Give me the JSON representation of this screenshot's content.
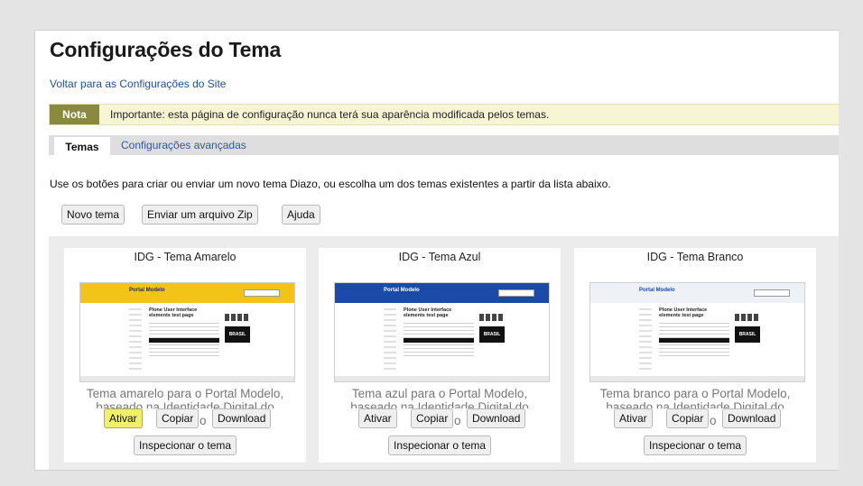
{
  "page": {
    "title": "Configurações do Tema",
    "back_link": "Voltar para as Configurações do Site"
  },
  "note": {
    "label": "Nota",
    "text": "Importante: esta página de configuração nunca terá sua aparência modificada pelos temas."
  },
  "tabs": [
    {
      "label": "Temas",
      "active": true
    },
    {
      "label": "Configurações avançadas",
      "active": false
    }
  ],
  "intro": "Use os botões para criar ou enviar um novo tema Diazo, ou escolha um dos temas existentes a partir da lista abaixo.",
  "toolbar": {
    "new_theme": "Novo tema",
    "upload_zip": "Enviar um arquivo Zip",
    "help": "Ajuda"
  },
  "themes": [
    {
      "name": "IDG - Tema Amarelo",
      "header_color": "#f2c417",
      "desc_line1": "Tema amarelo para o Portal Modelo,",
      "desc_line2": "baseado na Identidade Digital do",
      "desc_tail": "o",
      "thumb_logo": "Portal Modelo",
      "thumb_title": "Plone User Interface elements test page",
      "thumb_badge": "BRASIL",
      "activate": "Ativar",
      "copy": "Copiar",
      "download": "Download",
      "inspect": "Inspecionar o tema"
    },
    {
      "name": "IDG - Tema Azul",
      "header_color": "#1c4aa8",
      "desc_line1": "Tema azul para o Portal Modelo,",
      "desc_line2": "baseado na Identidade Digital do",
      "desc_tail": "o",
      "thumb_logo": "Portal Modelo",
      "thumb_title": "Plone User Interface elements test page",
      "thumb_badge": "BRASIL",
      "activate": "Ativar",
      "copy": "Copiar",
      "download": "Download",
      "inspect": "Inspecionar o tema"
    },
    {
      "name": "IDG - Tema Branco",
      "header_color": "#eef2f7",
      "desc_line1": "Tema branco para o Portal Modelo,",
      "desc_line2": "baseado na Identidade Digital do",
      "desc_tail": "o",
      "thumb_logo": "Portal Modelo",
      "thumb_title": "Plone User Interface elements test page",
      "thumb_badge": "BRASIL",
      "activate": "Ativar",
      "copy": "Copiar",
      "download": "Download",
      "inspect": "Inspecionar o tema"
    }
  ],
  "colors": {
    "highlight": "#f1f06a",
    "link": "#1f4f8f"
  }
}
